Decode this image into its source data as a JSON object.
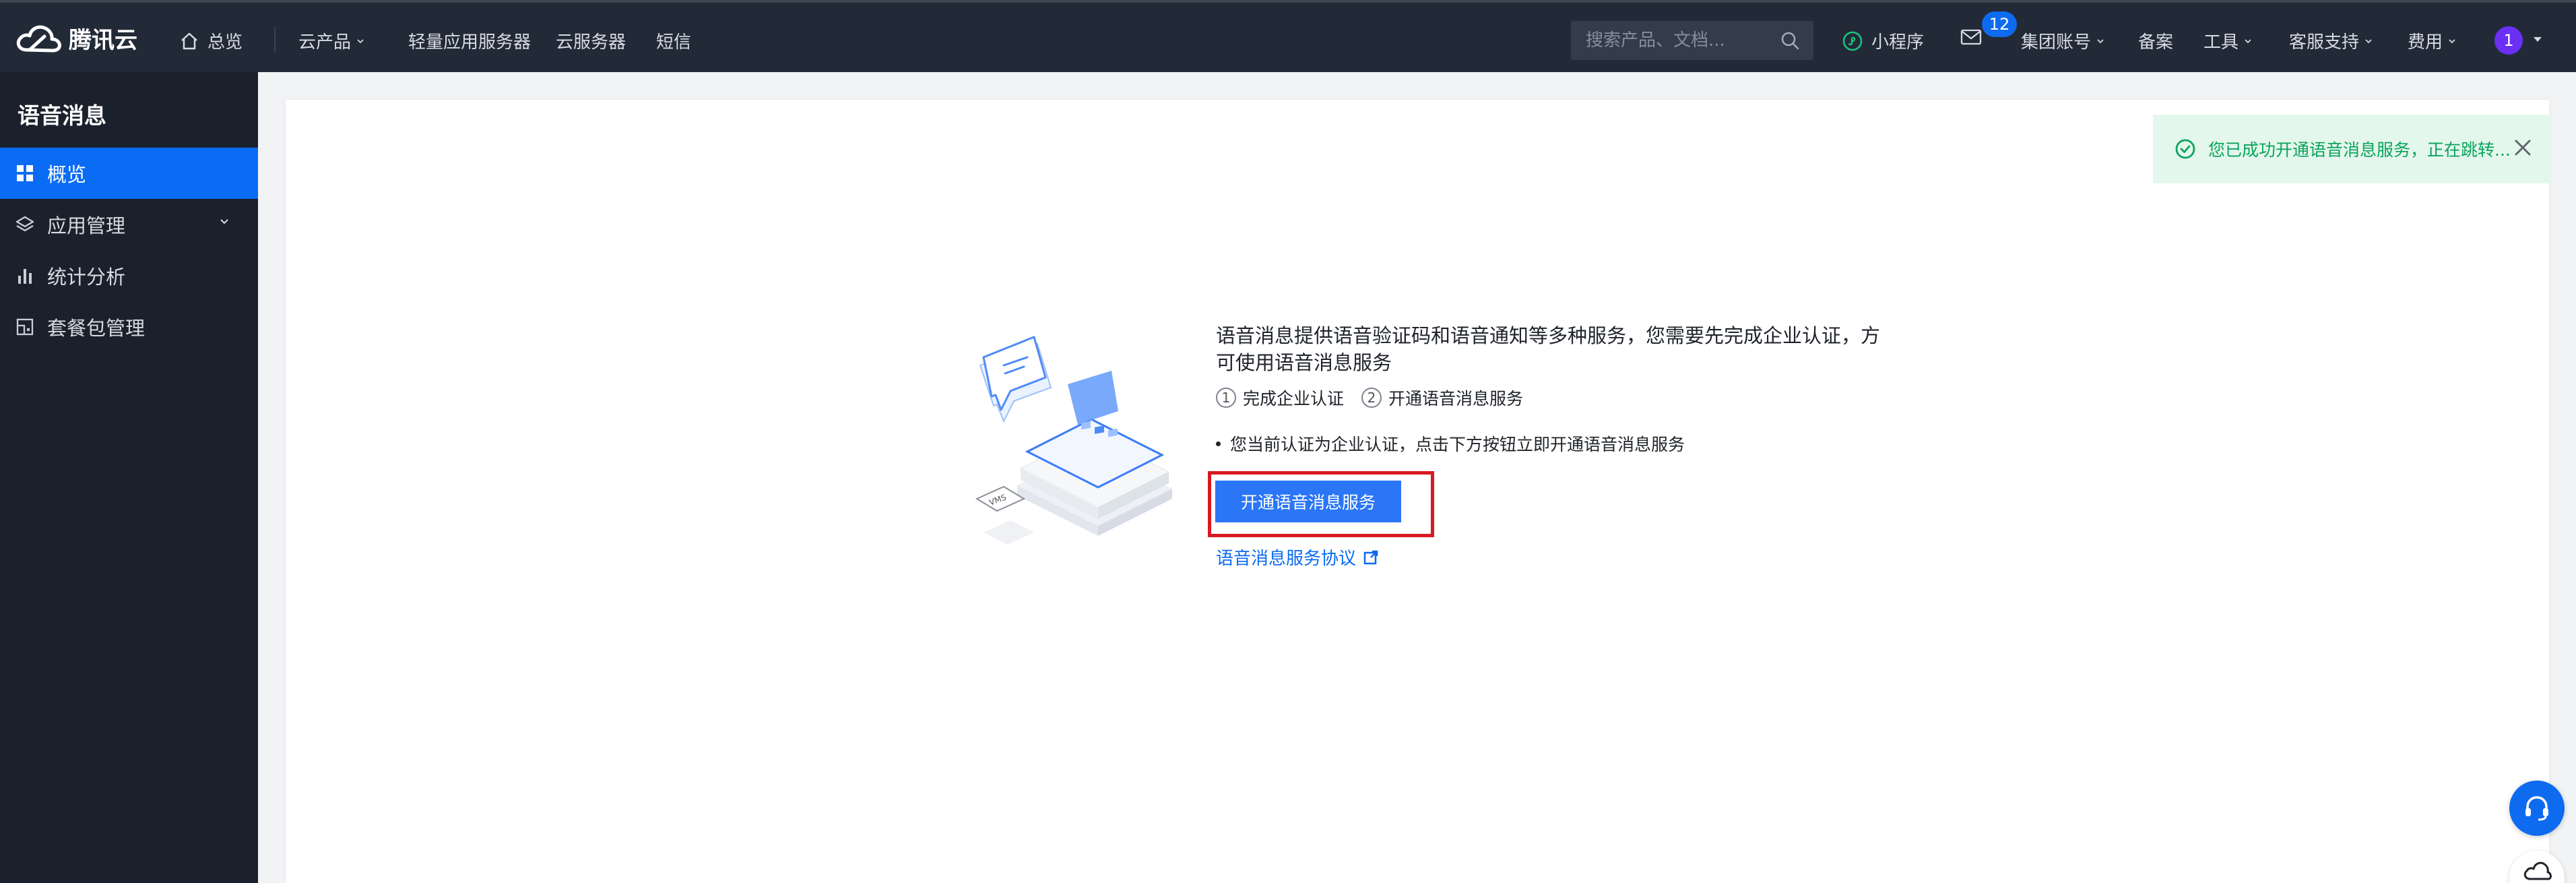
{
  "topbar": {
    "logo_text": "腾讯云",
    "nav": {
      "overview": "总览",
      "products": "云产品",
      "lighthouse": "轻量应用服务器",
      "cvm": "云服务器",
      "sms": "短信"
    },
    "search_placeholder": "搜索产品、文档...",
    "mini_program": "小程序",
    "message_count": "12",
    "group_account": "集团账号",
    "beian": "备案",
    "tools": "工具",
    "support": "客服支持",
    "billing": "费用",
    "avatar": "1"
  },
  "sidebar": {
    "title": "语音消息",
    "items": [
      {
        "label": "概览",
        "icon": "grid-icon",
        "active": true
      },
      {
        "label": "应用管理",
        "icon": "layers-icon",
        "active": false
      },
      {
        "label": "统计分析",
        "icon": "bar-chart-icon",
        "active": false
      },
      {
        "label": "套餐包管理",
        "icon": "package-icon",
        "active": false
      }
    ]
  },
  "main": {
    "description": "语音消息提供语音验证码和语音通知等多种服务，您需要先完成企业认证，方可使用语音消息服务",
    "steps": [
      {
        "num": "1",
        "label": "完成企业认证"
      },
      {
        "num": "2",
        "label": "开通语音消息服务"
      }
    ],
    "note": "您当前认证为企业认证，点击下方按钮立即开通语音消息服务",
    "button_label": "开通语音消息服务",
    "agreement_link": "语音消息服务协议",
    "illustration_label": "VMS"
  },
  "toast": {
    "message": "您已成功开通语音消息服务，正在跳转..."
  },
  "colors": {
    "topbar_bg": "#222a38",
    "sidebar_bg": "#1b212c",
    "accent": "#0a6bf5",
    "highlight": "#d71920",
    "toast_bg": "#e4f7ec",
    "toast_text": "#0aa35c"
  }
}
